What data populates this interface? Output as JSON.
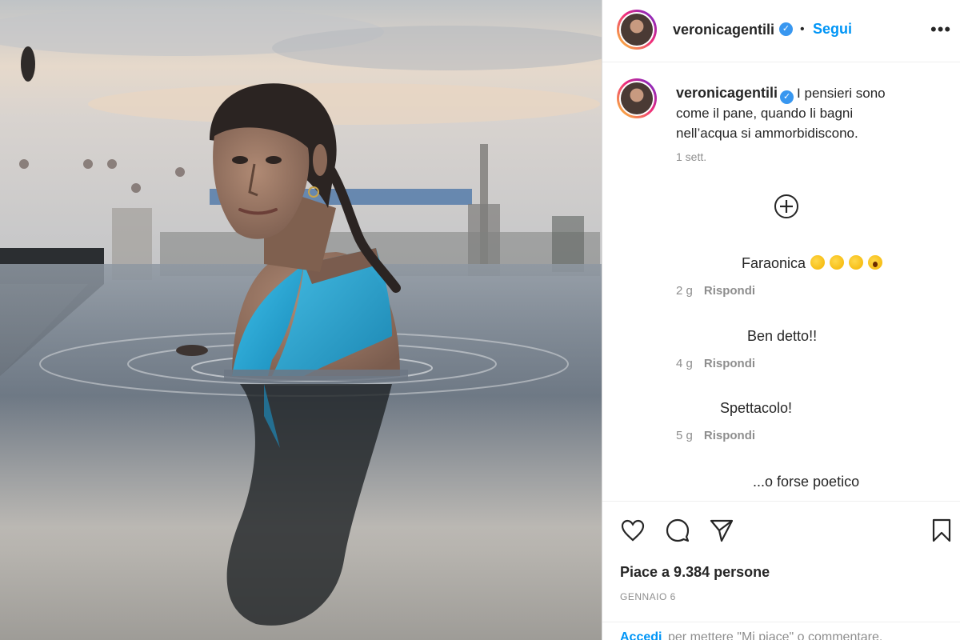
{
  "post": {
    "username": "veronicagentili",
    "verified_mark": "✓",
    "separator": "•",
    "follow_label": "Segui",
    "more_label": "•••",
    "caption": "I pensieri sono come il pane, quando li bagni nell’acqua si ammorbidiscono.",
    "caption_time": "1 sett."
  },
  "comments": [
    {
      "text": "Faraonica",
      "emojis": [
        "clap-emoji",
        "clap-emoji",
        "clap-emoji",
        "astonished-emoji"
      ],
      "time": "2 g",
      "reply_label": "Rispondi"
    },
    {
      "text": "Ben detto!!",
      "time": "4 g",
      "reply_label": "Rispondi"
    },
    {
      "text": "Spettacolo!",
      "time": "5 g",
      "reply_label": "Rispondi"
    },
    {
      "text": "...o forse poetico"
    }
  ],
  "actions": {
    "icons": [
      "heart-icon",
      "comment-icon",
      "share-icon",
      "bookmark-icon"
    ],
    "likes": "Piace a 9.384 persone",
    "date": "GENNAIO 6",
    "login_link": "Accedi",
    "login_rest": "per mettere \"Mi piace\" o commentare."
  },
  "colors": {
    "link": "#0095f6",
    "verified": "#3897f0",
    "swimsuit": "#1e9fd0"
  }
}
